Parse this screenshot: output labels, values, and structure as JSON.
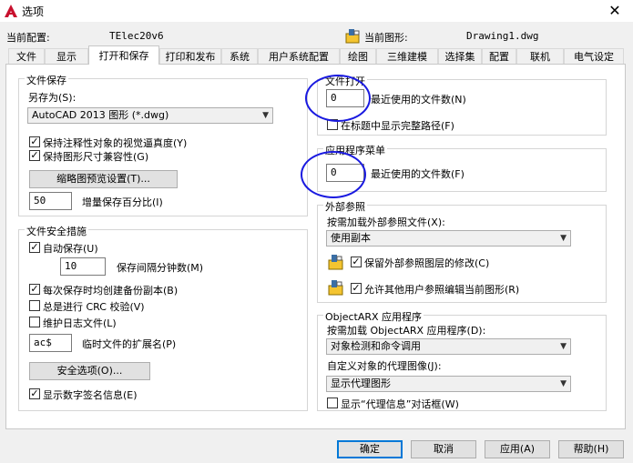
{
  "window": {
    "title": "选项",
    "close_glyph": "✕"
  },
  "profile": {
    "current_config_label": "当前配置:",
    "current_config_value": "TElec20v6",
    "current_drawing_label": "当前图形:",
    "current_drawing_value": "Drawing1.dwg"
  },
  "tabs": [
    "文件",
    "显示",
    "打开和保存",
    "打印和发布",
    "系统",
    "用户系统配置",
    "绘图",
    "三维建模",
    "选择集",
    "配置",
    "联机",
    "电气设定"
  ],
  "file_save": {
    "title": "文件保存",
    "save_as_label": "另存为(S):",
    "save_as_value": "AutoCAD 2013 图形 (*.dwg)",
    "keep_annotative": "保持注释性对象的视觉逼真度(Y)",
    "keep_size_compat": "保持图形尺寸兼容性(G)",
    "thumbnail_button": "缩略图预览设置(T)...",
    "incremental_value": "50",
    "incremental_label": "增量保存百分比(I)"
  },
  "file_safety": {
    "title": "文件安全措施",
    "autosave": "自动保存(U)",
    "autosave_minutes": "10",
    "autosave_minutes_label": "保存间隔分钟数(M)",
    "backup_each_save": "每次保存时均创建备份副本(B)",
    "crc_check": "总是进行 CRC 校验(V)",
    "log_file": "维护日志文件(L)",
    "temp_ext_value": "ac$",
    "temp_ext_label": "临时文件的扩展名(P)",
    "security_button": "安全选项(O)...",
    "digital_signature": "显示数字签名信息(E)"
  },
  "file_open": {
    "title": "文件打开",
    "recent_count": "0",
    "recent_label": "最近使用的文件数(N)",
    "full_path": "在标题中显示完整路径(F)"
  },
  "app_menu": {
    "title": "应用程序菜单",
    "recent_count": "0",
    "recent_label": "最近使用的文件数(F)"
  },
  "xref": {
    "title": "外部参照",
    "demand_load_label": "按需加载外部参照文件(X):",
    "demand_load_value": "使用副本",
    "retain_changes": "保留外部参照图层的修改(C)",
    "allow_edit": "允许其他用户参照编辑当前图形(R)"
  },
  "objectarx": {
    "title": "ObjectARX 应用程序",
    "demand_load_label": "按需加载 ObjectARX 应用程序(D):",
    "demand_load_value": "对象检测和命令调用",
    "proxy_images_label": "自定义对象的代理图像(J):",
    "proxy_images_value": "显示代理图形",
    "proxy_info": "显示“代理信息”对话框(W)"
  },
  "buttons": {
    "ok": "确定",
    "cancel": "取消",
    "apply": "应用(A)",
    "help": "帮助(H)"
  },
  "colors": {
    "annotation": "#1a1ae0",
    "default_button_border": "#0078d7",
    "app_icon": "#c8102e"
  }
}
